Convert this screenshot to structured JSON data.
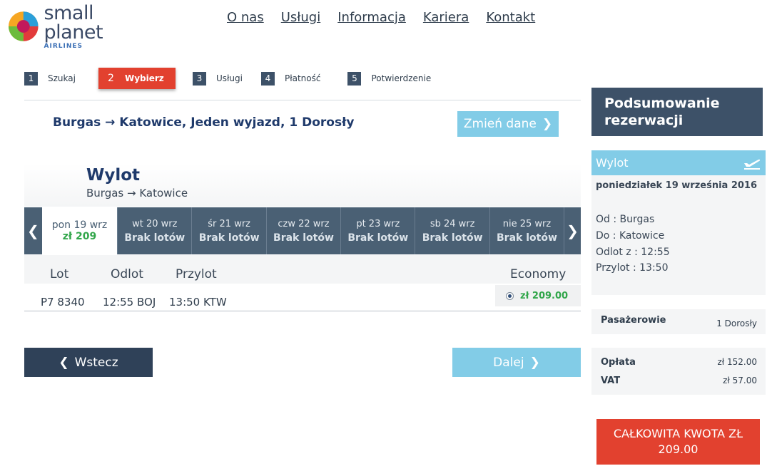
{
  "brand": {
    "name": "small planet",
    "sub": "AIRLINES"
  },
  "nav": [
    "O nas",
    "Usługi",
    "Informacja",
    "Kariera",
    "Kontakt"
  ],
  "steps": [
    {
      "num": "1",
      "label": "Szukaj"
    },
    {
      "num": "2",
      "label": "Wybierz"
    },
    {
      "num": "3",
      "label": "Usługi"
    },
    {
      "num": "4",
      "label": "Płatność"
    },
    {
      "num": "5",
      "label": "Potwierdzenie"
    }
  ],
  "summary": {
    "route": "Burgas → Katowice, Jeden wyjazd, 1 Dorosły",
    "change_label": "Zmień dane"
  },
  "flight": {
    "title": "Wylot",
    "route": "Burgas → Katowice",
    "dates": [
      {
        "day": "pon 19 wrz",
        "price": "zł 209"
      },
      {
        "day": "wt 20 wrz",
        "price": "Brak lotów"
      },
      {
        "day": "śr 21 wrz",
        "price": "Brak lotów"
      },
      {
        "day": "czw 22 wrz",
        "price": "Brak lotów"
      },
      {
        "day": "pt 23 wrz",
        "price": "Brak lotów"
      },
      {
        "day": "sb 24 wrz",
        "price": "Brak lotów"
      },
      {
        "day": "nie 25 wrz",
        "price": "Brak lotów"
      }
    ],
    "columns": {
      "lot": "Lot",
      "odlot": "Odlot",
      "przylot": "Przylot",
      "class": "Economy"
    },
    "row": {
      "lot": "P7 8340",
      "odlot": "12:55 BOJ",
      "przylot": "13:50 KTW",
      "price": "zł 209.00"
    }
  },
  "buttons": {
    "back": "Wstecz",
    "next": "Dalej"
  },
  "sidebar": {
    "title": "Podsumowanie rezerwacji",
    "wylot": "Wylot",
    "date": "poniedziałek 19 września 2016",
    "od": "Od : Burgas",
    "do": "Do : Katowice",
    "odlot": "Odlot z : 12:55",
    "przylot": "Przylot : 13:50",
    "passengers_label": "Pasażerowie",
    "passengers_value": "1 Dorosły",
    "fee_label": "Opłata",
    "fee_value": "zł 152.00",
    "vat_label": "VAT",
    "vat_value": "zł 57.00",
    "total": "CAŁKOWITA KWOTA  ZŁ 209.00"
  },
  "colors": {
    "accent_red": "#e2412f",
    "navy": "#3d5168",
    "light_blue": "#82cce7",
    "price_green": "#31a64a"
  }
}
